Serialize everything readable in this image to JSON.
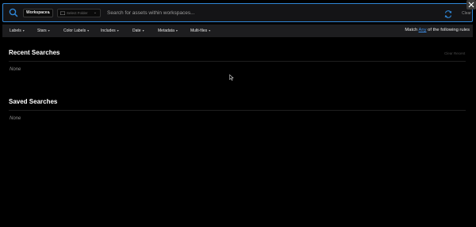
{
  "search": {
    "workspace_select": "Workspaces",
    "folder_placeholder": "Select Folder",
    "placeholder": "Search for assets within workspaces...",
    "clear_label": "Clear"
  },
  "filters": {
    "items": [
      {
        "label": "Labels"
      },
      {
        "label": "Stars"
      },
      {
        "label": "Color Labels"
      },
      {
        "label": "Includes"
      },
      {
        "label": "Date"
      },
      {
        "label": "Metadata"
      },
      {
        "label": "Multi-files"
      }
    ],
    "match_prefix": "Match",
    "match_value": "Any",
    "match_suffix": "of the following rules"
  },
  "recent": {
    "title": "Recent Searches",
    "clear_label": "Clear Recent",
    "empty": "None"
  },
  "saved": {
    "title": "Saved Searches",
    "empty": "None"
  },
  "colors": {
    "accent": "#2f86d6",
    "link": "#3d8ee8",
    "background": "#000000"
  }
}
